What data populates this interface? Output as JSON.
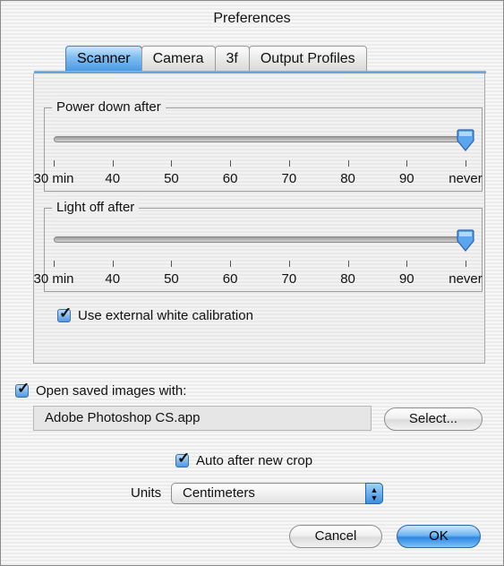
{
  "window": {
    "title": "Preferences"
  },
  "tabs": [
    {
      "label": "Scanner",
      "active": true
    },
    {
      "label": "Camera",
      "active": false
    },
    {
      "label": "3f",
      "active": false
    },
    {
      "label": "Output Profiles",
      "active": false
    }
  ],
  "power_down": {
    "label": "Power down after",
    "ticks": [
      "30 min",
      "40",
      "50",
      "60",
      "70",
      "80",
      "90",
      "never"
    ],
    "value": "never",
    "value_index": 7
  },
  "light_off": {
    "label": "Light off after",
    "ticks": [
      "30 min",
      "40",
      "50",
      "60",
      "70",
      "80",
      "90",
      "never"
    ],
    "value": "never",
    "value_index": 7
  },
  "external_white": {
    "label": "Use external white calibration",
    "checked": true
  },
  "open_saved": {
    "label": "Open saved images with:",
    "checked": true
  },
  "app_path": "Adobe Photoshop CS.app",
  "select_button": "Select...",
  "auto_crop": {
    "label": "Auto after new crop",
    "checked": true
  },
  "units": {
    "label": "Units",
    "value": "Centimeters"
  },
  "cancel_button": "Cancel",
  "ok_button": "OK",
  "colors": {
    "accent": "#4b9be3",
    "primary_button": "#2f86e0"
  },
  "icons": {
    "check": "check-mark-icon",
    "popup_arrows": "updown-arrows-icon",
    "slider_thumb": "slider-thumb-icon"
  }
}
